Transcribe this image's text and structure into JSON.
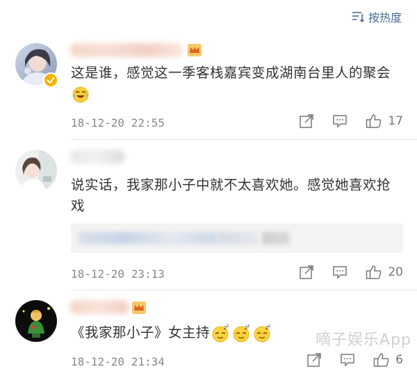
{
  "sort": {
    "label": "按热度",
    "icon": "sort-icon"
  },
  "comments": [
    {
      "text": "这是谁，感觉这一季客栈嘉宾变成湖南台里人的聚会",
      "emoji": "laugh-cry-emoji",
      "time": "18-12-20 22:55",
      "likes": "17",
      "verified": true,
      "crown": true
    },
    {
      "text": "说实话，我家那小子中就不太喜欢她。感觉她喜欢抢戏",
      "time": "18-12-20 23:13",
      "likes": "20",
      "verified": false,
      "crown": false,
      "has_quote": true
    },
    {
      "text": "《我家那小子》女主持",
      "emoji": "sleepy-emoji",
      "time": "18-12-20 21:34",
      "likes": "6",
      "verified": false,
      "crown": true
    }
  ],
  "icons": {
    "share": "share-icon",
    "reply": "comment-icon",
    "like": "thumbs-up-icon"
  },
  "watermark": "嘀子娱乐App",
  "colors": {
    "link": "#4a6a94",
    "meta": "#888888",
    "text": "#333333",
    "divider": "#e6e6e6"
  }
}
